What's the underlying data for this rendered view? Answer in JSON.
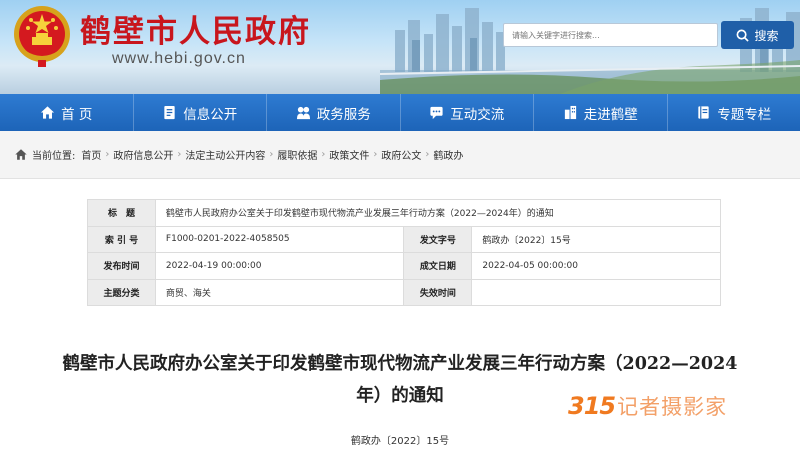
{
  "header": {
    "site_title": "鹤壁市人民政府",
    "site_url": "www.hebi.gov.cn",
    "search_placeholder": "请输入关键字进行搜索...",
    "search_button": "搜索"
  },
  "nav": {
    "items": [
      {
        "label": "首 页",
        "icon": "home-icon"
      },
      {
        "label": "信息公开",
        "icon": "document-icon"
      },
      {
        "label": "政务服务",
        "icon": "service-icon"
      },
      {
        "label": "互动交流",
        "icon": "chat-icon"
      },
      {
        "label": "走进鹤壁",
        "icon": "building-icon"
      },
      {
        "label": "专题专栏",
        "icon": "book-icon"
      }
    ]
  },
  "breadcrumb": {
    "lead": "当前位置:",
    "items": [
      "首页",
      "政府信息公开",
      "法定主动公开内容",
      "履职依据",
      "政策文件",
      "政府公文",
      "鹤政办"
    ],
    "separator": "›"
  },
  "info": {
    "title_label": "标　题",
    "title_value": "鹤壁市人民政府办公室关于印发鹤壁市现代物流产业发展三年行动方案（2022—2024年）的通知",
    "index_label": "索 引 号",
    "index_value": "F1000-0201-2022-4058505",
    "docno_label": "发文字号",
    "docno_value": "鹤政办〔2022〕15号",
    "publish_label": "发布时间",
    "publish_value": "2022-04-19 00:00:00",
    "created_label": "成文日期",
    "created_value": "2022-04-05 00:00:00",
    "topic_label": "主题分类",
    "topic_value": "商贸、海关",
    "expire_label": "失效时间",
    "expire_value": ""
  },
  "article": {
    "title_line1": "鹤壁市人民政府办公室关于印发鹤壁市现代物流产业发展三年行动方案（2022—2024",
    "title_line2": "年）的通知",
    "doc_number": "鹤政办〔2022〕15号"
  },
  "watermark": {
    "number": "315",
    "text": "记者摄影家"
  },
  "colors": {
    "brand_red": "#c8161d",
    "nav_blue": "#1d64b8",
    "search_blue": "#1f5fa8",
    "watermark_orange": "#f07a20"
  }
}
